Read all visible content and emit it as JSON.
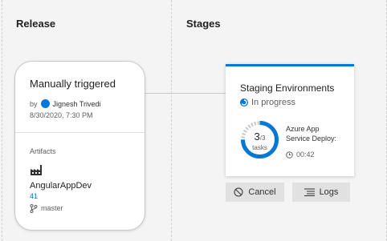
{
  "sections": {
    "release": "Release",
    "stages": "Stages"
  },
  "release_card": {
    "title": "Manually triggered",
    "by_label": "by",
    "user": "Jignesh Trivedi",
    "date": "8/30/2020, 7:30 PM",
    "artifacts_label": "Artifacts",
    "artifact_name": "AngularAppDev",
    "build_number": "41",
    "branch": "master"
  },
  "stage_card": {
    "title": "Staging Environments",
    "status": "In progress",
    "tasks_done": "3",
    "tasks_total": "/3",
    "tasks_label": "tasks",
    "job_line1": "Azure App",
    "job_line2": "Service Deploy:",
    "elapsed": "00:42",
    "progress_fraction": 0.75
  },
  "buttons": {
    "cancel": "Cancel",
    "logs": "Logs"
  },
  "colors": {
    "accent": "#0078d4",
    "button_bg": "#e1e1e1"
  },
  "icons": [
    "factory-icon",
    "branch-icon",
    "in-progress-icon",
    "clock-icon",
    "cancel-icon",
    "logs-icon"
  ]
}
